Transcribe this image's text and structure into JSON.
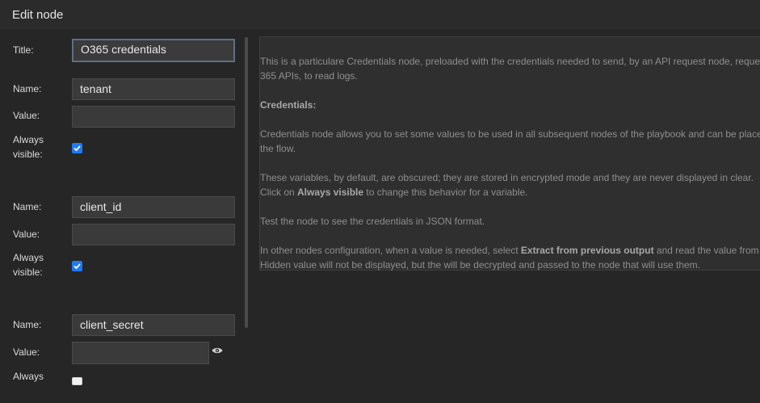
{
  "header": {
    "title": "Edit node"
  },
  "form": {
    "title_label": "Title:",
    "title_value": "O365 credentials",
    "groups": [
      {
        "name_label": "Name:",
        "name_value": "tenant",
        "value_label": "Value:",
        "value_value": "",
        "always_label_1": "Always",
        "always_label_2": "visible:",
        "checked": true
      },
      {
        "name_label": "Name:",
        "name_value": "client_id",
        "value_label": "Value:",
        "value_value": "",
        "always_label_1": "Always",
        "always_label_2": "visible:",
        "checked": true
      },
      {
        "name_label": "Name:",
        "name_value": "client_secret",
        "value_label": "Value:",
        "value_value": "",
        "always_label_1": "Always",
        "always_label_2": "",
        "checked": false,
        "icon": "eye-icon"
      }
    ]
  },
  "help": {
    "p1_line1": "This is a particulare Credentials node, preloaded with the credentials needed to send, by an API request node, request",
    "p1_line2": "365 APIs, to read logs.",
    "p2": "Credentials:",
    "p3_line1": "Credentials node allows you to set some values to be used in all subsequent nodes of the playbook and can be placed",
    "p3_line2": "the flow.",
    "p4_line1": "These variables, by default, are obscured; they are stored in encrypted mode and they are never displayed in clear.",
    "p4_line2_pre": "Click on ",
    "p4_line2_bold": "Always visible",
    "p4_line2_post": " to change this behavior for a variable.",
    "p5": "Test the node to see the credentials in JSON format.",
    "p6_line1_pre": "In other nodes configuration, when a value is needed, select ",
    "p6_line1_bold": "Extract from previous output",
    "p6_line1_post": " and read the value from this",
    "p6_line2": "Hidden value will not be displayed, but the will be decrypted and passed to the node that will use them."
  },
  "colors": {
    "accent": "#1e7bf2",
    "background": "#262626",
    "panel": "#2f2f2f"
  }
}
